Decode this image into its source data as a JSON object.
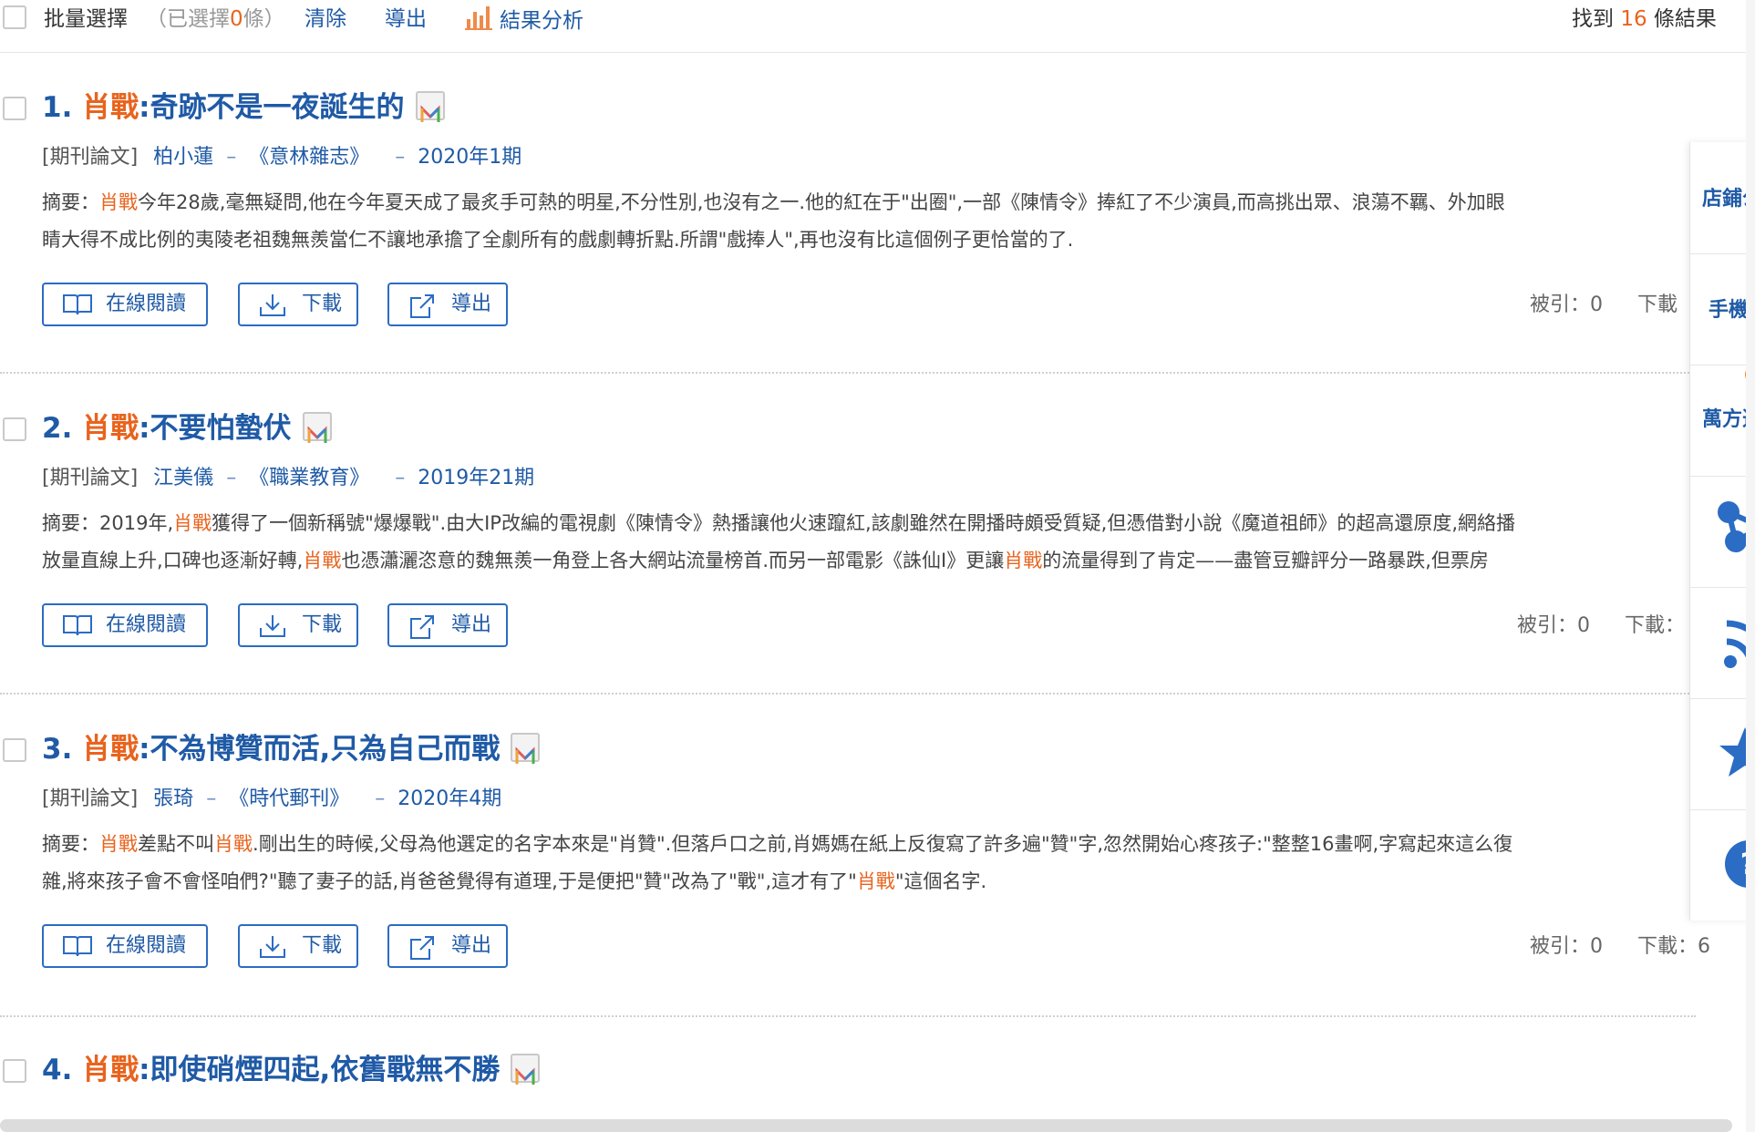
{
  "toolbar": {
    "batch_select": "批量選擇",
    "selected_prefix": "（已選擇",
    "selected_count": "0",
    "selected_suffix": "條）",
    "clear": "清除",
    "export": "導出",
    "analysis": "結果分析",
    "found_prefix": "找到",
    "found_count": "16",
    "found_suffix": "條結果"
  },
  "results": [
    {
      "index": "1.",
      "title_keyword": "肖戰",
      "title_rest": ":奇跡不是一夜誕生的",
      "type": "[期刊論文]",
      "author": "柏小蓮",
      "journal": "《意林雜志》",
      "issue": "2020年1期",
      "abstract_label": "摘要：",
      "abstract_line1_kw": "肖戰",
      "abstract_line1": "今年28歲,毫無疑問,他在今年夏天成了最炙手可熱的明星,不分性別,也沒有之一.他的紅在于\"出圈\",一部《陳情令》捧紅了不少演員,而高挑出眾、浪蕩不羈、外加眼",
      "abstract_line2": "睛大得不成比例的夷陵老祖魏無羨當仁不讓地承擔了全劇所有的戲劇轉折點.所謂\"戲捧人\",再也沒有比這個例子更恰當的了.",
      "btn_read": "在線閱讀",
      "btn_download": "下載",
      "btn_export": "導出",
      "cited": "被引：0",
      "downloads": "下載"
    },
    {
      "index": "2.",
      "title_keyword": "肖戰",
      "title_rest": ":不要怕蟄伏",
      "type": "[期刊論文]",
      "author": "江美儀",
      "journal": "《職業教育》",
      "issue": "2019年21期",
      "abstract_label": "摘要：",
      "abstract_line1_pre": "2019年,",
      "abstract_line1_kw": "肖戰",
      "abstract_line1": "獲得了一個新稱號\"爆爆戰\".由大IP改編的電視劇《陳情令》熱播讓他火速躥紅,該劇雖然在開播時頗受質疑,但憑借對小說《魔道祖師》的超高還原度,網絡播",
      "abstract_line2_a": "放量直線上升,口碑也逐漸好轉,",
      "abstract_line2_kw1": "肖戰",
      "abstract_line2_b": "也憑瀟灑恣意的魏無羨一角登上各大網站流量榜首.而另一部電影《誅仙Ⅰ》更讓",
      "abstract_line2_kw2": "肖戰",
      "abstract_line2_c": "的流量得到了肯定——盡管豆瓣評分一路暴跌,但票房",
      "btn_read": "在線閱讀",
      "btn_download": "下載",
      "btn_export": "導出",
      "cited": "被引：0",
      "downloads": "下載："
    },
    {
      "index": "3.",
      "title_keyword": "肖戰",
      "title_rest": ":不為博贊而活,只為自己而戰",
      "type": "[期刊論文]",
      "author": "張琦",
      "journal": "《時代郵刊》",
      "issue": "2020年4期",
      "abstract_label": "摘要：",
      "abstract_line1_kw": "肖戰",
      "abstract_line1_a": "差點不叫",
      "abstract_line1_kw2": "肖戰",
      "abstract_line1": ".剛出生的時候,父母為他選定的名字本來是\"肖贊\".但落戶口之前,肖媽媽在紙上反復寫了許多遍\"贊\"字,忽然開始心疼孩子:\"整整16畫啊,字寫起來這么復",
      "abstract_line2_a": "雜,將來孩子會不會怪咱們?\"聽了妻子的話,肖爸爸覺得有道理,于是便把\"贊\"改為了\"戰\",這才有了\"",
      "abstract_line2_kw": "肖戰",
      "abstract_line2_b": "\"這個名字.",
      "btn_read": "在線閱讀",
      "btn_download": "下載",
      "btn_export": "導出",
      "cited": "被引：0",
      "downloads": "下載：6"
    },
    {
      "index": "4.",
      "title_keyword": "肖戰",
      "title_rest": ":即使硝煙四起,依舊戰無不勝"
    }
  ],
  "sidebar": {
    "shop": "店鋪公",
    "mobile": "手機",
    "wanfang": "萬方選"
  },
  "colors": {
    "link_blue": "#1f5aa6",
    "keyword_orange": "#e8641e",
    "button_border": "#2b6cc4"
  }
}
